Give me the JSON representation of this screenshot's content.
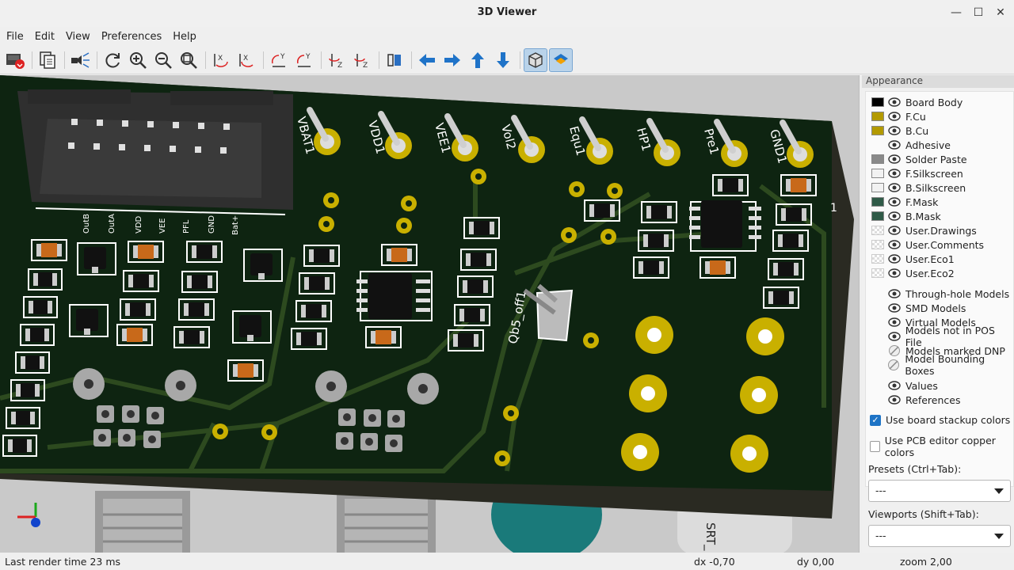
{
  "window": {
    "title": "3D Viewer"
  },
  "menu": [
    "File",
    "Edit",
    "View",
    "Preferences",
    "Help"
  ],
  "toolbar": {
    "buttons": [
      "reload-board-icon",
      "copy-image-icon",
      "raytrace-icon",
      "refresh-icon",
      "zoom-in-icon",
      "zoom-out-icon",
      "zoom-fit-icon",
      "rotate-x-cw-icon",
      "rotate-x-ccw-icon",
      "rotate-y-cw-icon",
      "rotate-y-ccw-icon",
      "rotate-z-cw-icon",
      "rotate-z-ccw-icon",
      "flip-board-icon",
      "move-left-icon",
      "move-right-icon",
      "move-up-icon",
      "move-down-icon",
      "orthographic-icon",
      "layers-manager-icon"
    ]
  },
  "viewport": {
    "silk_labels": [
      "VBAT1",
      "VDD1",
      "VEE1",
      "Vol2",
      "Equ1",
      "HP1",
      "Pre1",
      "GND1"
    ],
    "header_pins": [
      "OutB",
      "OutA",
      "VDD",
      "VEE",
      "PFL",
      "GND",
      "Bat+"
    ],
    "switch_label": "Qb5_off1",
    "bottom_label": "SRT_",
    "colors": {
      "board": "#0d1f10",
      "copper": "#c9b000",
      "silk": "#ffffff",
      "background": "#c9c9c9"
    }
  },
  "appearance": {
    "title": "Appearance",
    "layers": [
      {
        "name": "Board Body",
        "color": "#000000",
        "swatch": "solid"
      },
      {
        "name": "F.Cu",
        "color": "#b39a00",
        "swatch": "solid"
      },
      {
        "name": "B.Cu",
        "color": "#b39a00",
        "swatch": "solid"
      },
      {
        "name": "Adhesive",
        "color": "",
        "swatch": "none"
      },
      {
        "name": "Solder Paste",
        "color": "#8a8a8a",
        "swatch": "solid"
      },
      {
        "name": "F.Silkscreen",
        "color": "#f2f2f2",
        "swatch": "solid"
      },
      {
        "name": "B.Silkscreen",
        "color": "#f2f2f2",
        "swatch": "solid"
      },
      {
        "name": "F.Mask",
        "color": "#2f5a47",
        "swatch": "solid"
      },
      {
        "name": "B.Mask",
        "color": "#2f5a47",
        "swatch": "solid"
      },
      {
        "name": "User.Drawings",
        "color": "",
        "swatch": "checker"
      },
      {
        "name": "User.Comments",
        "color": "",
        "swatch": "checker"
      },
      {
        "name": "User.Eco1",
        "color": "",
        "swatch": "checker"
      },
      {
        "name": "User.Eco2",
        "color": "",
        "swatch": "checker"
      }
    ],
    "models": [
      {
        "name": "Through-hole Models",
        "icon": "eye-icon"
      },
      {
        "name": "SMD Models",
        "icon": "eye-icon"
      },
      {
        "name": "Virtual Models",
        "icon": "eye-icon"
      },
      {
        "name": "Models not in POS File",
        "icon": "eye-icon"
      },
      {
        "name": "Models marked DNP",
        "icon": "hidden-icon"
      },
      {
        "name": "Model Bounding Boxes",
        "icon": "hidden-icon"
      }
    ],
    "extras": [
      {
        "name": "Values",
        "icon": "eye-icon"
      },
      {
        "name": "References",
        "icon": "eye-icon"
      }
    ],
    "use_stackup": {
      "label": "Use board stackup colors",
      "checked": true
    },
    "use_pcb_copper": {
      "label": "Use PCB editor copper colors",
      "checked": false
    },
    "presets": {
      "label": "Presets (Ctrl+Tab):",
      "value": "---"
    },
    "viewports": {
      "label": "Viewports (Shift+Tab):",
      "value": "---"
    }
  },
  "status": {
    "render_time": "Last render time 23 ms",
    "dx": "dx -0,70",
    "dy": "dy 0,00",
    "zoom": "zoom 2,00"
  }
}
